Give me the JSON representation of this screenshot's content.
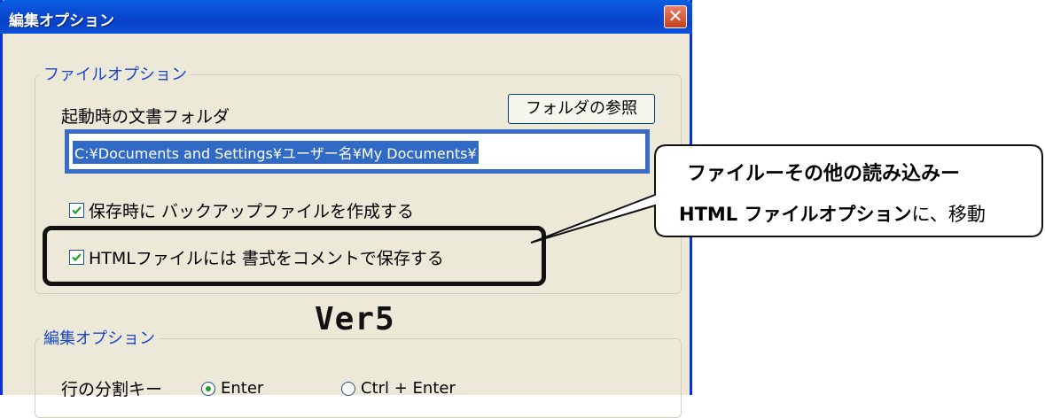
{
  "window": {
    "title": "編集オプション",
    "close_glyph": "✕"
  },
  "file_options": {
    "legend": "ファイルオプション",
    "startup_folder_label": "起動時の文書フォルダ",
    "browse_button": "フォルダの参照",
    "path_value": "C:¥Documents and Settings¥ユーザー名¥My Documents¥",
    "backup_checkbox": {
      "label": "保存時に バックアップファイルを作成する",
      "checked": true
    },
    "html_checkbox": {
      "label": "HTMLファイルには 書式をコメントで保存する",
      "checked": true
    }
  },
  "version_label": "Ver5",
  "edit_options": {
    "legend": "編集オプション",
    "line_split_label": "行の分割キー",
    "radio_options": [
      {
        "label": "Enter",
        "selected": true
      },
      {
        "label": "Ctrl + Enter",
        "selected": false
      }
    ]
  },
  "callout": {
    "line1": "ファイルーその他の読み込みー",
    "line2_bold": "HTML ファイルオプション",
    "line2_rest": "に、移動"
  },
  "colors": {
    "title_bar": "#0a4fd6",
    "dialog_bg": "#ece9d8",
    "legend_text": "#1c46c8",
    "selection": "#316ac5"
  }
}
